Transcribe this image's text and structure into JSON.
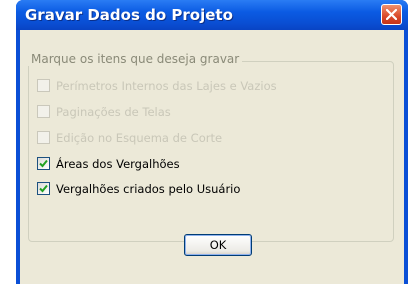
{
  "dialog": {
    "title": "Gravar Dados do Projeto",
    "group_label": "Marque os itens que deseja gravar",
    "items": [
      {
        "label": "Perímetros Internos das Lajes e Vazios",
        "checked": false,
        "enabled": false
      },
      {
        "label": "Paginações de Telas",
        "checked": false,
        "enabled": false
      },
      {
        "label": "Edição no Esquema de Corte",
        "checked": false,
        "enabled": false
      },
      {
        "label": "Áreas dos Vergalhões",
        "checked": true,
        "enabled": true
      },
      {
        "label": "Vergalhões criados pelo Usuário",
        "checked": true,
        "enabled": true
      }
    ],
    "ok_label": "OK"
  },
  "colors": {
    "titlebar": "#0a4fd6",
    "close_button": "#d9492a",
    "dialog_background": "#ece9d8",
    "check_mark": "#21a121"
  },
  "icons": {
    "close": "close-icon",
    "check": "check-icon"
  }
}
